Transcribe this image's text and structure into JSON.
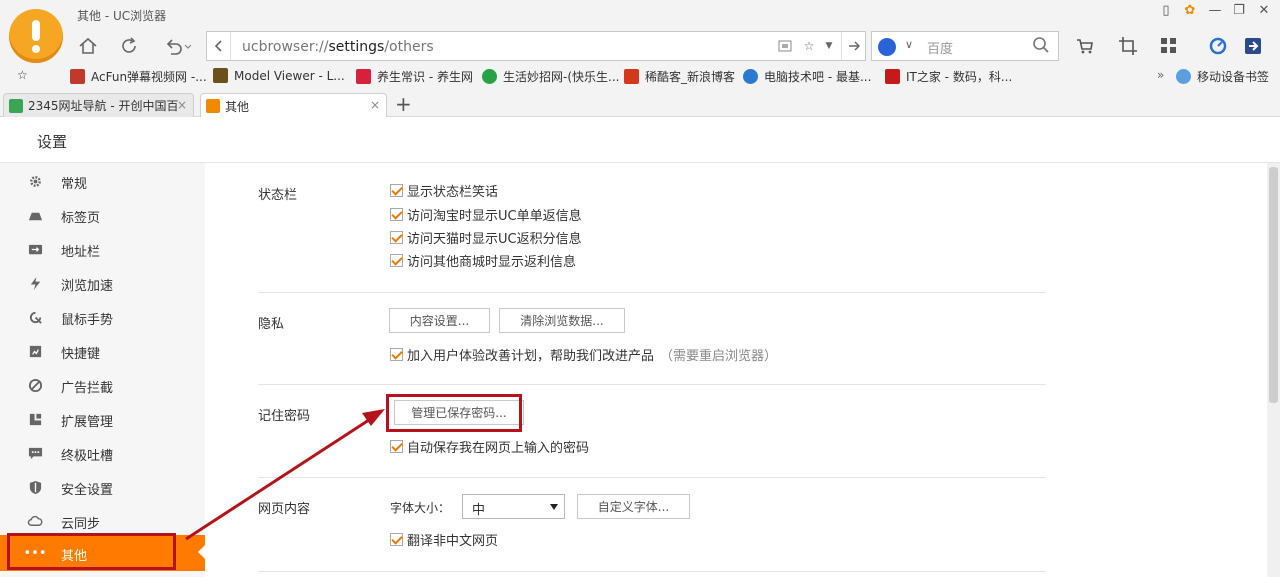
{
  "window": {
    "title": "其他 - UC浏览器"
  },
  "address_bar": {
    "url_scheme": "ucbrowser://",
    "url_host": "settings",
    "url_path": "/others"
  },
  "search_box": {
    "placeholder": "百度",
    "engine_icon": "baidu-paw-icon"
  },
  "bookmarks": [
    {
      "label": "AcFun弹幕视频网 -...",
      "color": "#c0392b"
    },
    {
      "label": "Model Viewer - L...",
      "color": "#6b4f1d"
    },
    {
      "label": "养生常识 - 养生网",
      "color": "#d6213b"
    },
    {
      "label": "生活妙招网-(快乐生...",
      "color": "#27a244"
    },
    {
      "label": "稀酷客_新浪博客",
      "color": "#d4381c"
    },
    {
      "label": "电脑技术吧 - 最基...",
      "color": "#2a7bd0"
    },
    {
      "label": "IT之家 - 数码，科...",
      "color": "#c41a1a"
    }
  ],
  "bookmarks_more": "»",
  "mobile_bookmarks": "移动设备书签",
  "tabs": [
    {
      "label": "2345网址导航 - 开创中国百",
      "active": false
    },
    {
      "label": "其他",
      "active": true
    }
  ],
  "settings": {
    "header": "设置",
    "sidebar": [
      {
        "label": "常规",
        "icon": "gear-icon"
      },
      {
        "label": "标签页",
        "icon": "tab-icon"
      },
      {
        "label": "地址栏",
        "icon": "address-bar-icon"
      },
      {
        "label": "浏览加速",
        "icon": "lightning-icon"
      },
      {
        "label": "鼠标手势",
        "icon": "mouse-gesture-icon"
      },
      {
        "label": "快捷键",
        "icon": "shortcut-icon"
      },
      {
        "label": "广告拦截",
        "icon": "block-icon"
      },
      {
        "label": "扩展管理",
        "icon": "extension-icon"
      },
      {
        "label": "终极吐槽",
        "icon": "chat-icon"
      },
      {
        "label": "安全设置",
        "icon": "shield-icon"
      },
      {
        "label": "云同步",
        "icon": "cloud-icon"
      },
      {
        "label": "其他",
        "icon": "more-dots-icon",
        "active": true
      }
    ],
    "status_bar": {
      "title": "状态栏",
      "options": [
        "显示状态栏笑话",
        "访问淘宝时显示UC单单返信息",
        "访问天猫时显示UC返积分信息",
        "访问其他商城时显示返利信息"
      ]
    },
    "privacy": {
      "title": "隐私",
      "content_settings_btn": "内容设置...",
      "clear_data_btn": "清除浏览数据...",
      "ux_plan": "加入用户体验改善计划，帮助我们改进产品",
      "ux_plan_hint": "（需要重启浏览器）"
    },
    "passwords": {
      "title": "记住密码",
      "manage_btn": "管理已保存密码...",
      "auto_save": "自动保存我在网页上输入的密码"
    },
    "web_content": {
      "title": "网页内容",
      "font_size_label": "字体大小：",
      "font_size_value": "中",
      "custom_font_btn": "自定义字体...",
      "translate": "翻译非中文网页"
    }
  }
}
